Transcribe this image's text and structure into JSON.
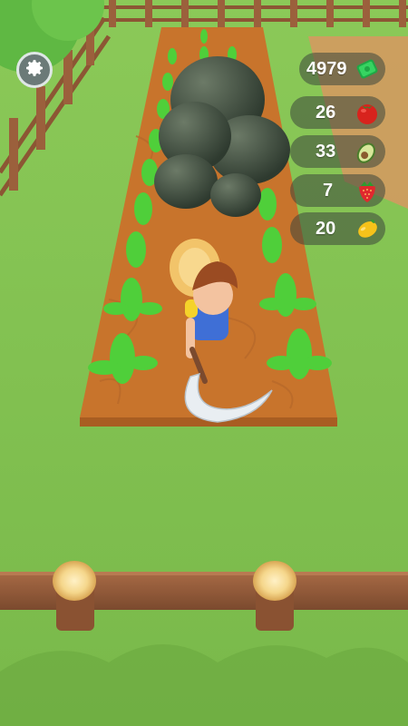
{
  "hud": {
    "cash": {
      "value": "4979",
      "icon": "cash-bundle-icon",
      "color": "#2ecc59"
    },
    "tomato": {
      "value": "26",
      "icon": "tomato-icon",
      "color": "#d8231d"
    },
    "avocado": {
      "value": "33",
      "icon": "avocado-icon",
      "color": "#6a9a3a"
    },
    "strawberry": {
      "value": "7",
      "icon": "strawberry-icon",
      "color": "#e0282e"
    },
    "lemon": {
      "value": "20",
      "icon": "lemon-icon",
      "color": "#f6c21a"
    }
  },
  "settings": {
    "icon": "gear-icon"
  },
  "scene": {
    "ground_color": "#86c653",
    "field_color": "#c8742c",
    "fence_color": "#a0603a"
  }
}
